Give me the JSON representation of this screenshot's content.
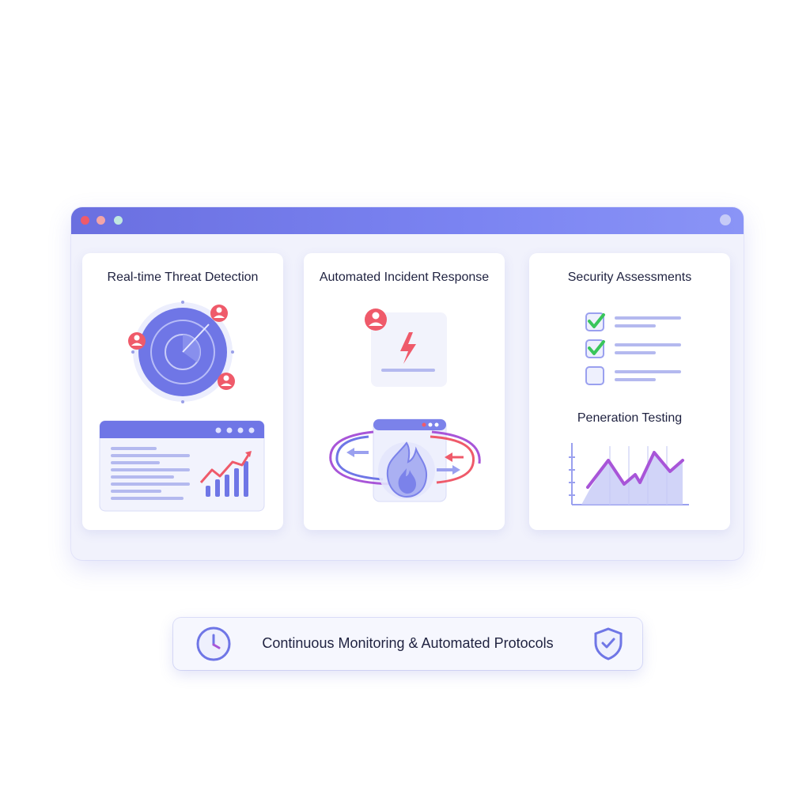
{
  "window": {
    "controls": [
      "close-dot",
      "minimize-dot",
      "maximize-dot"
    ]
  },
  "cards": [
    {
      "title": "Real-time Threat Detection",
      "icons": [
        "radar-icon",
        "user-alert-icon",
        "dashboard-window-icon",
        "trend-chart-icon"
      ]
    },
    {
      "title": "Automated Incident Response",
      "icons": [
        "alert-panel-icon",
        "lightning-icon",
        "fire-icon",
        "cycle-arrows-icon"
      ]
    },
    {
      "title": "Security Assessments",
      "checklist": [
        {
          "checked": true
        },
        {
          "checked": true
        },
        {
          "checked": false
        }
      ],
      "subtitle": "Peneration Testing",
      "icons": [
        "checklist-icon",
        "line-chart-icon"
      ]
    }
  ],
  "banner": {
    "text": "Continuous Monitoring & Automated Protocols",
    "icons": [
      "clock-icon",
      "shield-check-icon"
    ]
  },
  "colors": {
    "accent": "#6a6fe0",
    "alert": "#ef5a6a",
    "check": "#39c65a",
    "chart_line": "#a855d8"
  }
}
